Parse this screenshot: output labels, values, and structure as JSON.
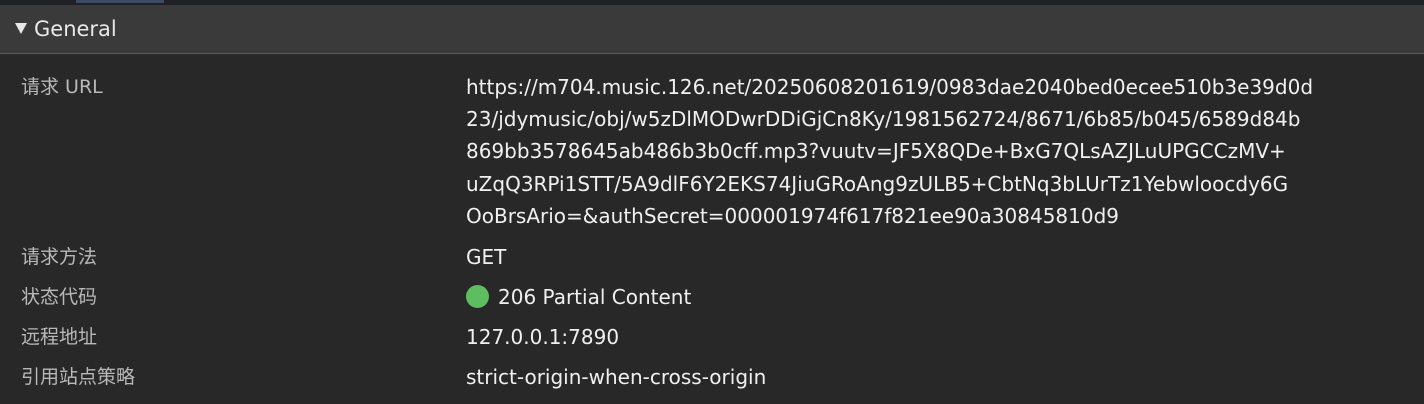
{
  "section": {
    "title": "General"
  },
  "general": {
    "request_url": {
      "key": "请求 URL",
      "lines": [
        "https://m704.music.126.net/20250608201619/0983dae2040bed0ecee510b3e39d0d",
        "23/jdymusic/obj/w5zDlMODwrDDiGjCn8Ky/1981562724/8671/6b85/b045/6589d84b",
        "869bb3578645ab486b3b0cff.mp3?vuutv=JF5X8QDe+BxG7QLsAZJLuUPGCCzMV+",
        "uZqQ3RPi1STT/5A9dlF6Y2EKS74JiuGRoAng9zULB5+CbtNq3bLUrTz1Yebwloocdy6G",
        "OoBrsArio=&authSecret=000001974f617f821ee90a30845810d9"
      ]
    },
    "request_method": {
      "key": "请求方法",
      "value": "GET"
    },
    "status_code": {
      "key": "状态代码",
      "value": "206 Partial Content",
      "dot_color": "#5ebd5e"
    },
    "remote_address": {
      "key": "远程地址",
      "value": "127.0.0.1:7890"
    },
    "referrer_policy": {
      "key": "引用站点策略",
      "value": "strict-origin-when-cross-origin"
    }
  }
}
